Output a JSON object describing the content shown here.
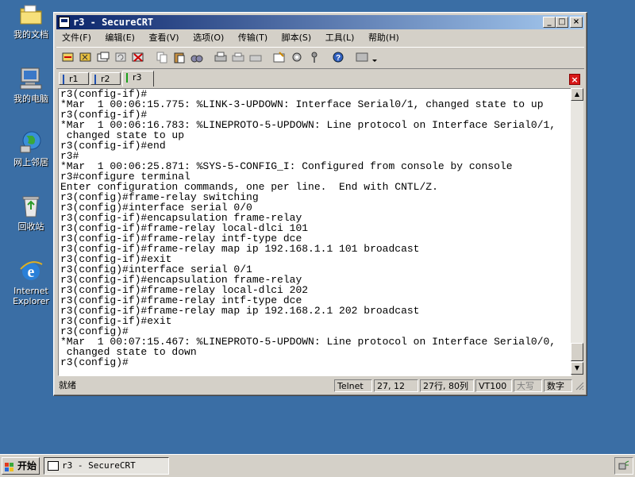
{
  "desktop": {
    "icons": [
      {
        "label": "我的文档"
      },
      {
        "label": "我的电脑"
      },
      {
        "label": "网上邻居"
      },
      {
        "label": "回收站"
      },
      {
        "label_line1": "Internet",
        "label_line2": "Explorer"
      }
    ]
  },
  "window": {
    "title": "r3 - SecureCRT",
    "controls": {
      "minimize": "_",
      "maximize": "□",
      "close": "×"
    },
    "menu": [
      "文件(F)",
      "编辑(E)",
      "查看(V)",
      "选项(O)",
      "传输(T)",
      "脚本(S)",
      "工具(L)",
      "帮助(H)"
    ],
    "tabs": [
      {
        "label": "r1",
        "color": "#1f4fb0"
      },
      {
        "label": "r2",
        "color": "#1f4fb0"
      },
      {
        "label": "r3",
        "color": "#1aa01a"
      }
    ],
    "tab_close": "×",
    "terminal_lines": [
      "r3(config-if)#",
      "*Mar  1 00:06:15.775: %LINK-3-UPDOWN: Interface Serial0/1, changed state to up",
      "r3(config-if)#",
      "*Mar  1 00:06:16.783: %LINEPROTO-5-UPDOWN: Line protocol on Interface Serial0/1,",
      " changed state to up",
      "r3(config-if)#end",
      "r3#",
      "*Mar  1 00:06:25.871: %SYS-5-CONFIG_I: Configured from console by console",
      "r3#configure terminal",
      "Enter configuration commands, one per line.  End with CNTL/Z.",
      "r3(config)#frame-relay switching",
      "r3(config)#interface serial 0/0",
      "r3(config-if)#encapsulation frame-relay",
      "r3(config-if)#frame-relay local-dlci 101",
      "r3(config-if)#frame-relay intf-type dce",
      "r3(config-if)#frame-relay map ip 192.168.1.1 101 broadcast",
      "r3(config-if)#exit",
      "r3(config)#interface serial 0/1",
      "r3(config-if)#encapsulation frame-relay",
      "r3(config-if)#frame-relay local-dlci 202",
      "r3(config-if)#frame-relay intf-type dce",
      "r3(config-if)#frame-relay map ip 192.168.2.1 202 broadcast",
      "r3(config-if)#exit",
      "r3(config)#",
      "*Mar  1 00:07:15.467: %LINEPROTO-5-UPDOWN: Line protocol on Interface Serial0/0,",
      " changed state to down",
      "r3(config)#"
    ],
    "status": {
      "ready": "就绪",
      "protocol": "Telnet",
      "cursor": "27,  12",
      "size": "27行, 80列",
      "emulation": "VT100",
      "caps": "大写",
      "num": "数字"
    }
  },
  "taskbar": {
    "start_label": "开始",
    "task_title": "r3 - SecureCRT"
  }
}
